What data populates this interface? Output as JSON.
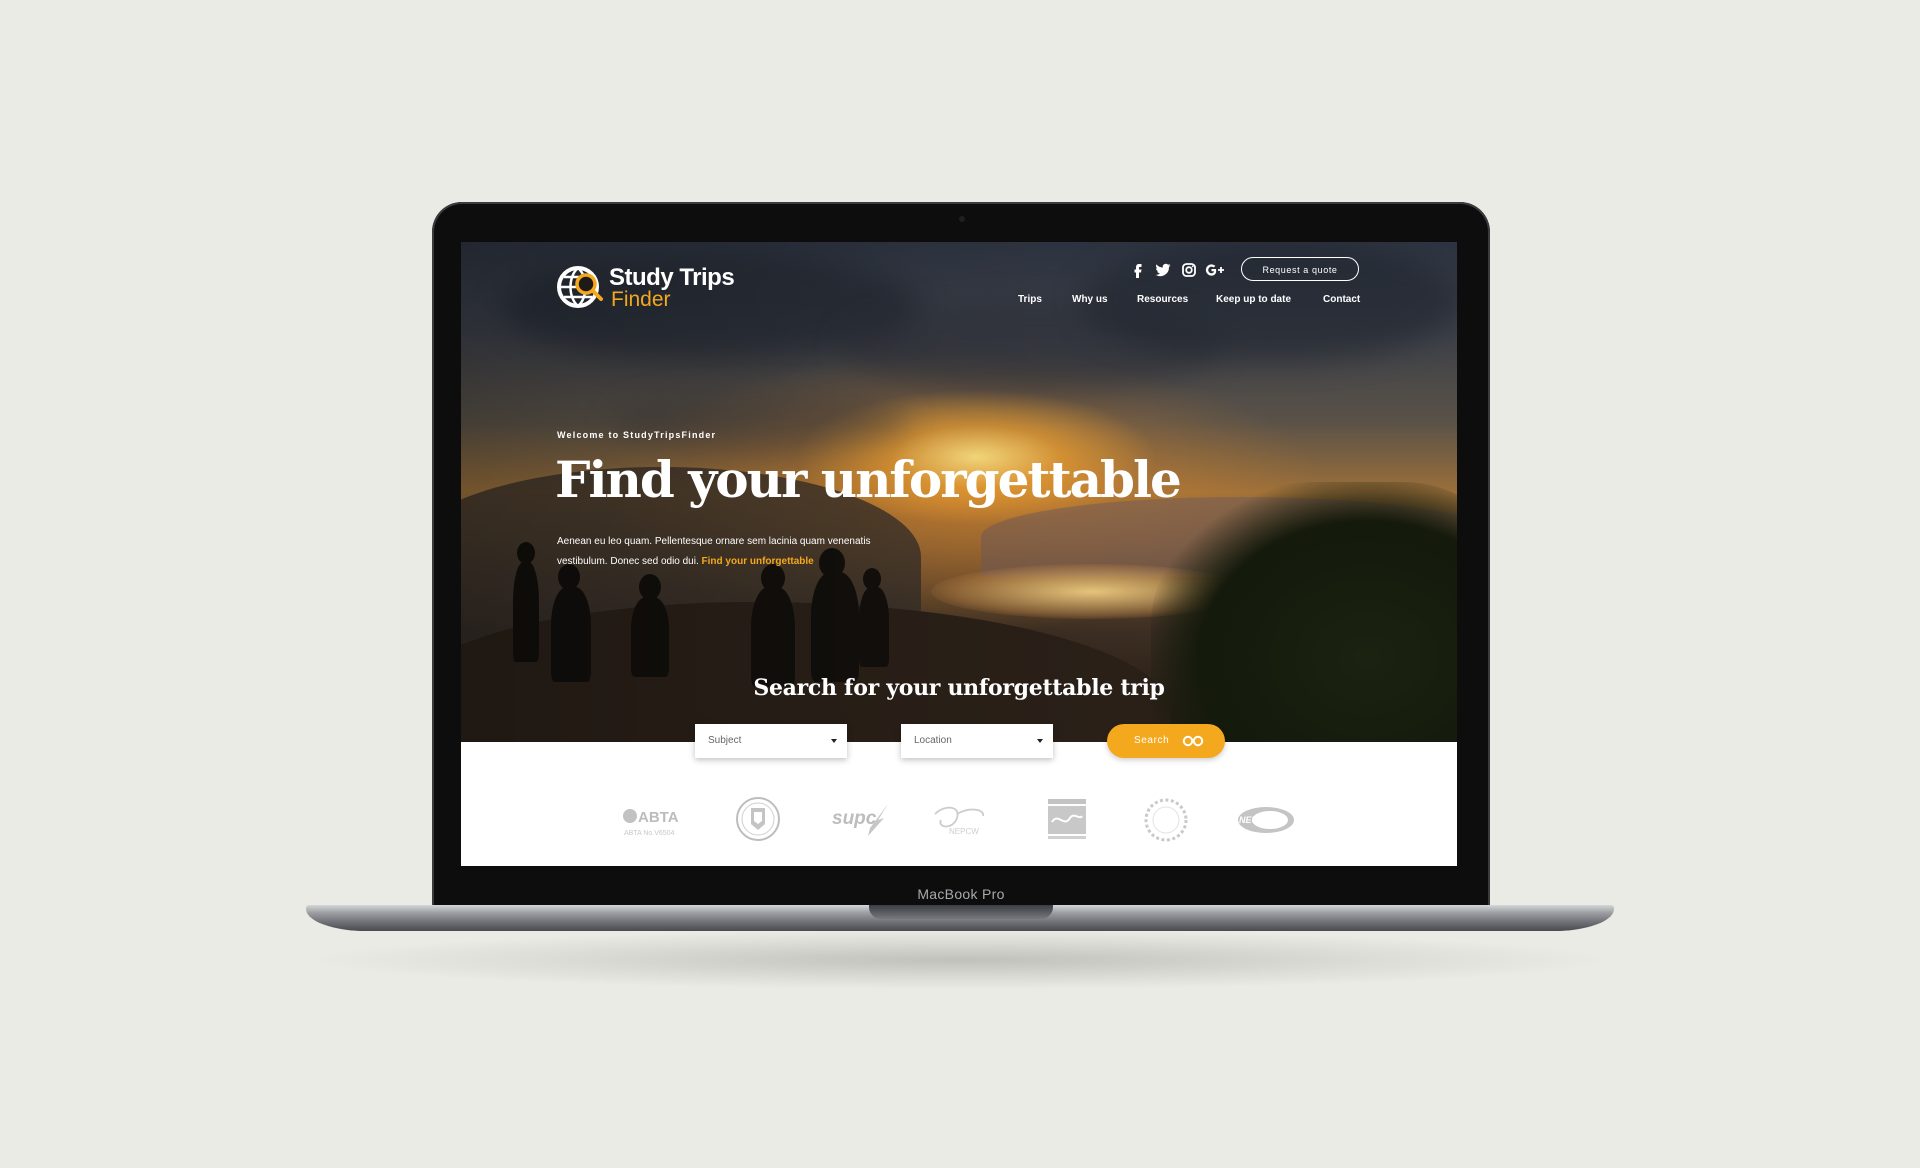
{
  "device": {
    "label": "MacBook Pro"
  },
  "brand": {
    "line1": "Study Trips",
    "line2": "Finder",
    "accent": "#f4a81d"
  },
  "header": {
    "social": [
      "facebook-icon",
      "twitter-icon",
      "instagram-icon",
      "google-plus-icon"
    ],
    "quote_button": "Request a quote",
    "nav": [
      "Trips",
      "Why us",
      "Resources",
      "Keep up to date",
      "Contact"
    ]
  },
  "hero": {
    "eyebrow": "Welcome to StudyTripsFinder",
    "title": "Find your unforgettable",
    "text": "Aenean eu leo quam. Pellentesque ornare sem lacinia quam venenatis vestibulum. Donec sed odio dui.",
    "link": "Find your unforgettable"
  },
  "search": {
    "title": "Search for your unforgettable trip",
    "subject_placeholder": "Subject",
    "location_placeholder": "Location",
    "button": "Search"
  },
  "partners": {
    "abta": "ABTA",
    "abta_sub": "ABTA No.V6504",
    "supc": "supc",
    "nepcw": "NEPCW",
    "neupc": "NEUPC"
  }
}
